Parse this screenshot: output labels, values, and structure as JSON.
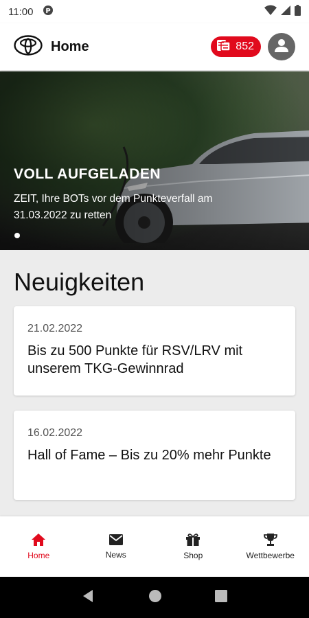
{
  "status_bar": {
    "time": "11:00"
  },
  "app_bar": {
    "title": "Home",
    "points": "852"
  },
  "hero": {
    "title": "VOLL AUFGELADEN",
    "text": "ZEIT, Ihre BOTs vor dem Punkteverfall am 31.03.2022 zu retten",
    "slide_index": 1
  },
  "news": {
    "section_title": "Neuigkeiten",
    "items": [
      {
        "date": "21.02.2022",
        "headline": "Bis zu 500 Punkte für RSV/LRV mit unserem TKG-Gewinnrad"
      },
      {
        "date": "16.02.2022",
        "headline": "Hall of Fame – Bis zu 20% mehr Punkte"
      }
    ]
  },
  "bottom_nav": {
    "items": [
      {
        "label": "Home",
        "icon": "home-icon"
      },
      {
        "label": "News",
        "icon": "mail-icon"
      },
      {
        "label": "Shop",
        "icon": "gift-icon"
      },
      {
        "label": "Wettbewerbe",
        "icon": "trophy-icon"
      }
    ]
  },
  "colors": {
    "accent": "#e10a1d",
    "background": "#ececec"
  }
}
